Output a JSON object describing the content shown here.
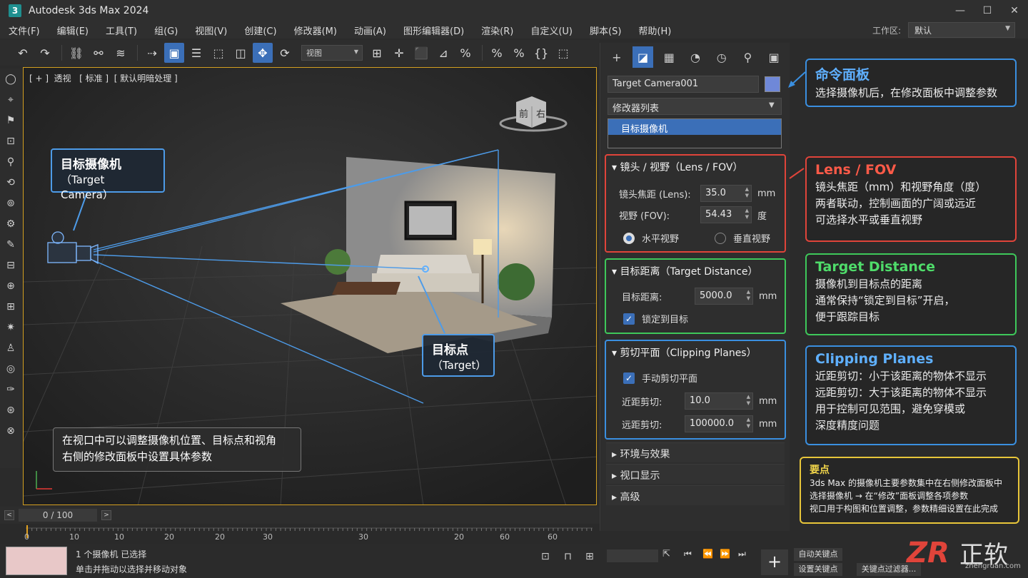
{
  "app": {
    "title": "Autodesk 3ds Max 2024",
    "icon": "3",
    "win": [
      "—",
      "☐",
      "✕"
    ]
  },
  "menu": [
    "文件(F)",
    "编辑(E)",
    "工具(T)",
    "组(G)",
    "视图(V)",
    "创建(C)",
    "修改器(M)",
    "动画(A)",
    "图形编辑器(D)",
    "渲染(R)",
    "自定义(U)",
    "脚本(S)",
    "帮助(H)"
  ],
  "workspace": {
    "label": "工作区:",
    "value": "默认"
  },
  "toolbar": {
    "view_select": "视图"
  },
  "viewport": {
    "label": "[ + ]  透视   [ 标准 ]  [ 默认明暗处理 ]",
    "cube_front": "前",
    "cube_right": "右"
  },
  "callouts": {
    "camera_title": "目标摄像机",
    "camera_sub": "（Target Camera）",
    "target_title": "目标点",
    "target_sub": "（Target）",
    "hint1": "在视口中可以调整摄像机位置、目标点和视角",
    "hint2": "右侧的修改面板中设置具体参数"
  },
  "timeline": {
    "frame": "0 / 100",
    "prev": "<",
    "next": ">",
    "ticks": [
      "0",
      "10",
      "10",
      "20",
      "20",
      "30",
      "30",
      "20",
      "60",
      "60"
    ]
  },
  "status": {
    "selected": "1 个摄像机  已选择",
    "hint": "单击并拖动以选择并移动对象",
    "auto_key": "自动关键点",
    "set_key": "设置关键点",
    "key_filter": "关键点过滤器..."
  },
  "cmd": {
    "object_name": "Target Camera001",
    "object_color": "#6f88d8",
    "modifier_list": "修改器列表",
    "stack_item": "目标摄像机",
    "lens": {
      "title": "镜头 / 视野（Lens / FOV）",
      "lens_label": "镜头焦距 (Lens):",
      "lens_value": "35.0",
      "lens_unit": "mm",
      "fov_label": "视野 (FOV):",
      "fov_value": "54.43",
      "fov_unit": "度",
      "radio_h": "水平视野",
      "radio_v": "垂直视野"
    },
    "target": {
      "title": "目标距离（Target Distance）",
      "dist_label": "目标距离:",
      "dist_value": "5000.0",
      "dist_unit": "mm",
      "lock": "锁定到目标"
    },
    "clip": {
      "title": "剪切平面（Clipping Planes）",
      "manual": "手动剪切平面",
      "near_label": "近距剪切:",
      "near_value": "10.0",
      "near_unit": "mm",
      "far_label": "远距剪切:",
      "far_value": "100000.0",
      "far_unit": "mm"
    },
    "env": "环境与效果",
    "display": "视口显示",
    "advanced": "高级"
  },
  "info": {
    "cmd": {
      "title": "命令面板",
      "lines": [
        "选择摄像机后，在修改面板中调整参数"
      ]
    },
    "lens": {
      "title": "Lens / FOV",
      "lines": [
        "镜头焦距（mm）和视野角度（度）",
        "两者联动，控制画面的广阔或远近",
        "可选择水平或垂直视野"
      ]
    },
    "target": {
      "title": "Target Distance",
      "lines": [
        "摄像机到目标点的距离",
        "通常保持“锁定到目标”开启，",
        "便于跟踪目标"
      ]
    },
    "clip": {
      "title": "Clipping Planes",
      "lines": [
        "近距剪切：小于该距离的物体不显示",
        "远距剪切：大于该距离的物体不显示",
        "用于控制可见范围，避免穿模或",
        "深度精度问题"
      ]
    },
    "tips": {
      "title": "要点",
      "lines": [
        "3ds Max 的摄像机主要参数集中在右侧修改面板中",
        "选择摄像机 → 在“修改”面板调整各项参数",
        "视口用于构图和位置调整，参数精细设置在此完成"
      ]
    }
  },
  "logo": {
    "text": "正软",
    "mark": "ZR",
    "url": "zhengruan.com"
  },
  "colors": {
    "accent": "#3b6fb8",
    "red": "#e0443a",
    "green": "#3ec85a",
    "blue": "#3a8fe0",
    "yellow": "#e8c63a"
  }
}
